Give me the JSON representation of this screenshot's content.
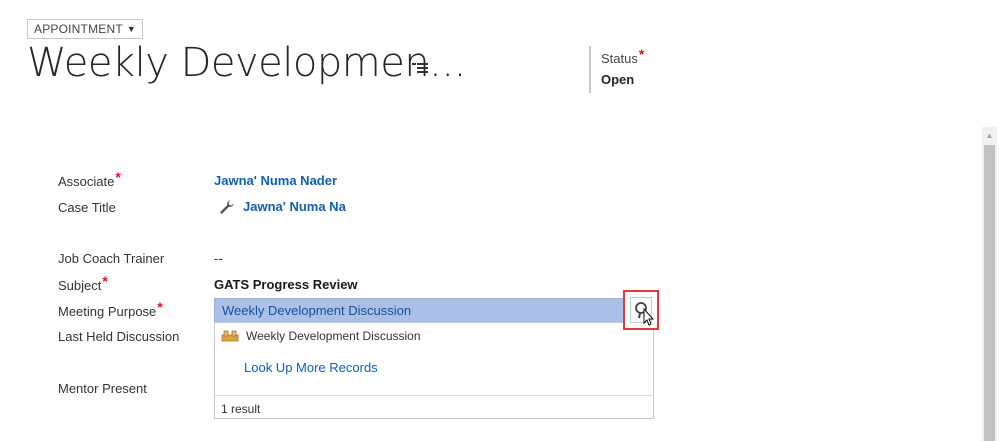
{
  "header": {
    "entity_type": "APPOINTMENT",
    "title": "Weekly Developmen...",
    "status_label": "Status",
    "status_value": "Open",
    "required_mark": "*"
  },
  "form": {
    "associate": {
      "label": "Associate",
      "value": "Jawna' Numa Nader"
    },
    "case_title": {
      "label": "Case Title",
      "value": "Jawna' Numa Na"
    },
    "job_coach_trainer": {
      "label": "Job Coach Trainer",
      "value": "--"
    },
    "subject": {
      "label": "Subject",
      "value": "GATS Progress Review"
    },
    "meeting_purpose": {
      "label": "Meeting Purpose",
      "value": "Weekly Development Discussion"
    },
    "last_held_discussion": {
      "label": "Last Held Discussion"
    },
    "mentor_present": {
      "label": "Mentor Present"
    }
  },
  "lookup_dropdown": {
    "items": [
      "Weekly Development Discussion"
    ],
    "more_records": "Look Up More Records",
    "result_count": "1 result"
  },
  "icons": {
    "title_menu": "list-menu-icon",
    "case_title": "wrench-icon",
    "lookup_search": "search-icon",
    "record": "record-type-icon",
    "cursor": "mouse-pointer-icon"
  },
  "colors": {
    "link": "#1160b7",
    "required": "#e81123",
    "lookup_highlight": "#aac0e6",
    "highlight_border": "#e0393e"
  }
}
